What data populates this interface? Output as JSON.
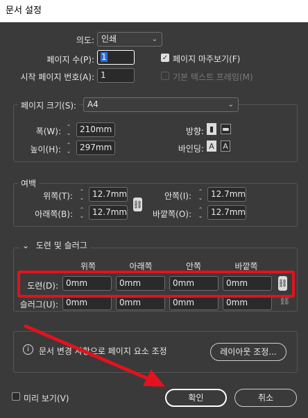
{
  "window": {
    "title": "문서 설정"
  },
  "intent": {
    "label": "의도:",
    "value": "인쇄"
  },
  "pages": {
    "label": "페이지 수(P):",
    "value": "1"
  },
  "start_page": {
    "label": "시작 페이지 번호(A):",
    "value": "1"
  },
  "facing_pages": {
    "label": "페이지 마주보기(F)",
    "checked": true
  },
  "primary_text_frame": {
    "label": "기본 텍스트 프레임(M)",
    "checked": false,
    "disabled": true
  },
  "page_size": {
    "label": "페이지 크기(S):",
    "value": "A4",
    "width_label": "폭(W):",
    "width": "210mm",
    "height_label": "높이(H):",
    "height": "297mm",
    "orientation_label": "방향:",
    "binding_label": "바인딩:"
  },
  "margins": {
    "title": "여백",
    "top_label": "위쪽(T):",
    "top": "12.7mm",
    "bottom_label": "아래쪽(B):",
    "bottom": "12.7mm",
    "inside_label": "안쪽(I):",
    "inside": "12.7mm",
    "outside_label": "바깥쪽(O):",
    "outside": "12.7mm"
  },
  "bleed_slug": {
    "title": "도련 및 슬러그",
    "col_top": "위쪽",
    "col_bottom": "아래쪽",
    "col_inside": "안쪽",
    "col_outside": "바깥쪽",
    "bleed_label": "도련(D):",
    "bleed": [
      "0mm",
      "0mm",
      "0mm",
      "0mm"
    ],
    "slug_label": "슬러그(U):",
    "slug": [
      "0mm",
      "0mm",
      "0mm",
      "0mm"
    ]
  },
  "info": {
    "message": "문서 변경 사항으로 페이지 요소 조정",
    "adjust_button": "레이아웃 조정..."
  },
  "preview": {
    "label": "미리 보기(V)",
    "checked": false
  },
  "buttons": {
    "ok": "확인",
    "cancel": "취소"
  },
  "colors": {
    "highlight": "#e2121f",
    "background": "#3a3a3a"
  }
}
